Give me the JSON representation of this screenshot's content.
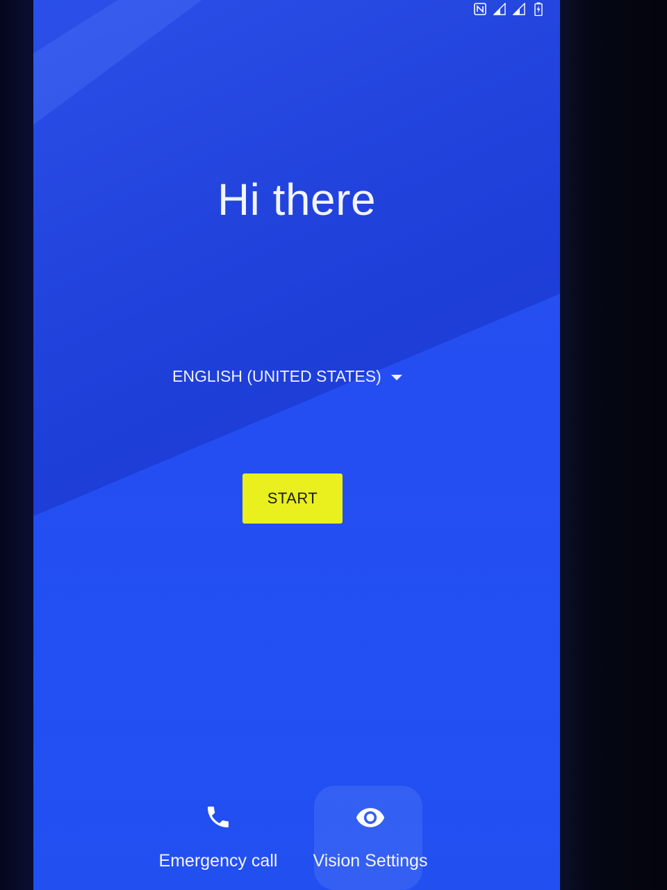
{
  "status_bar": {
    "icons": [
      "nfc-icon",
      "signal-icon",
      "signal-icon",
      "battery-charging-icon"
    ]
  },
  "welcome": {
    "title": "Hi there"
  },
  "language": {
    "selected": "ENGLISH (UNITED STATES)"
  },
  "start": {
    "label": "START"
  },
  "bottom_actions": {
    "emergency_label": "Emergency call",
    "vision_label": "Vision Settings"
  },
  "colors": {
    "background": "#1d3ef0",
    "start_button": "#e9f01e",
    "text": "#f2f4ff"
  }
}
